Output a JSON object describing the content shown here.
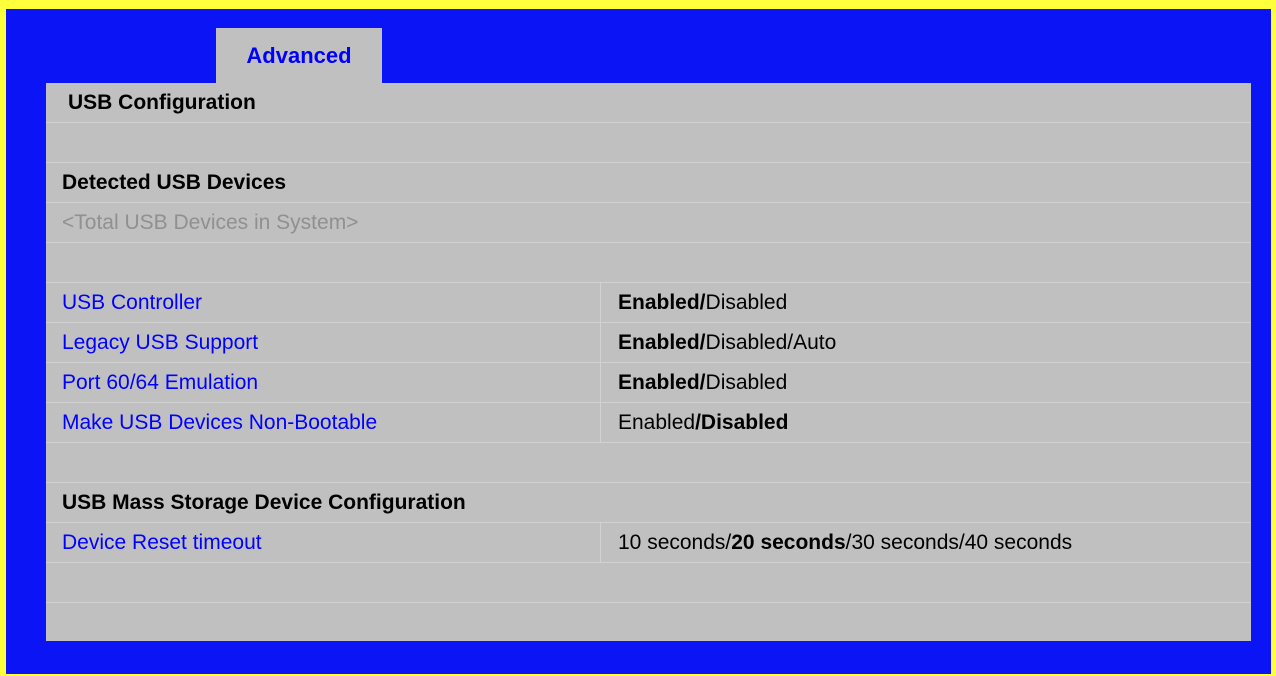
{
  "tab": {
    "label": "Advanced"
  },
  "page": {
    "title": "USB Configuration"
  },
  "detected": {
    "heading": "Detected USB Devices",
    "placeholder": "<Total USB Devices in System>"
  },
  "settings": [
    {
      "label": "USB Controller",
      "options": [
        {
          "text": "Enabled/",
          "bold": true
        },
        {
          "text": "Disabled",
          "bold": false
        }
      ]
    },
    {
      "label": "Legacy USB Support",
      "options": [
        {
          "text": "Enabled/",
          "bold": true
        },
        {
          "text": "Disabled/Auto",
          "bold": false
        }
      ]
    },
    {
      "label": "Port 60/64 Emulation",
      "options": [
        {
          "text": "Enabled/",
          "bold": true
        },
        {
          "text": "Disabled",
          "bold": false
        }
      ]
    },
    {
      "label": "Make USB Devices Non-Bootable",
      "options": [
        {
          "text": "Enabled",
          "bold": false
        },
        {
          "text": "/Disabled",
          "bold": true
        }
      ]
    }
  ],
  "mass_storage": {
    "heading": "USB Mass Storage Device Configuration",
    "setting": {
      "label": "Device Reset timeout",
      "options": [
        {
          "text": "10 seconds/",
          "bold": false
        },
        {
          "text": "20 seconds",
          "bold": true
        },
        {
          "text": "/30 seconds/40 seconds",
          "bold": false
        }
      ]
    }
  },
  "colors": {
    "frame_blue": "#0a14f5",
    "border_yellow": "#ffff3c",
    "panel_grey": "#c0c0c0",
    "setting_blue": "#0000ff",
    "placeholder_grey": "#909090"
  }
}
